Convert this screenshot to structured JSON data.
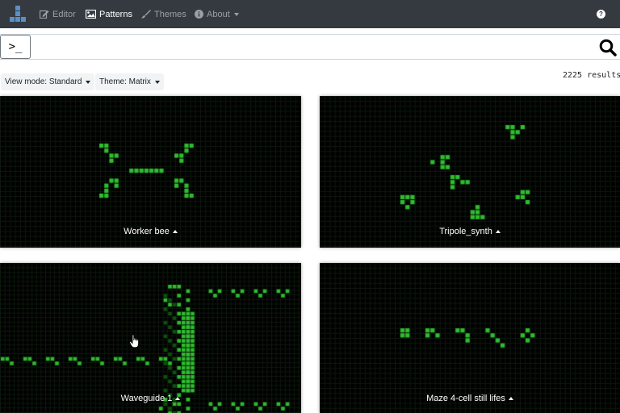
{
  "navbar": {
    "items": [
      {
        "label": "Editor",
        "icon": "edit-icon",
        "active": false
      },
      {
        "label": "Patterns",
        "icon": "image-icon",
        "active": true
      },
      {
        "label": "Themes",
        "icon": "brush-icon",
        "active": false
      },
      {
        "label": "About",
        "icon": "info-icon",
        "active": false,
        "has_caret": true
      }
    ],
    "help_icon": "question-circle-icon",
    "help_glyph": "?"
  },
  "search": {
    "prompt_glyph": ">_",
    "value": "",
    "placeholder": "",
    "search_icon": "search-icon"
  },
  "filters": {
    "view_mode": "View mode: Standard",
    "theme": "Theme: Matrix"
  },
  "results_count": "2225 results",
  "colors": {
    "navbar_bg": "#343a40",
    "cell_alive": "#2ebd2e",
    "cell_dim": "#0f4f0f",
    "grid": "#0e1a0e",
    "card_bg": "#000000"
  },
  "cards": [
    {
      "title": "Worker bee"
    },
    {
      "title": "Tripole_synth"
    },
    {
      "title": "Waveguide 1"
    },
    {
      "title": "Maze 4-cell still lifes"
    }
  ]
}
